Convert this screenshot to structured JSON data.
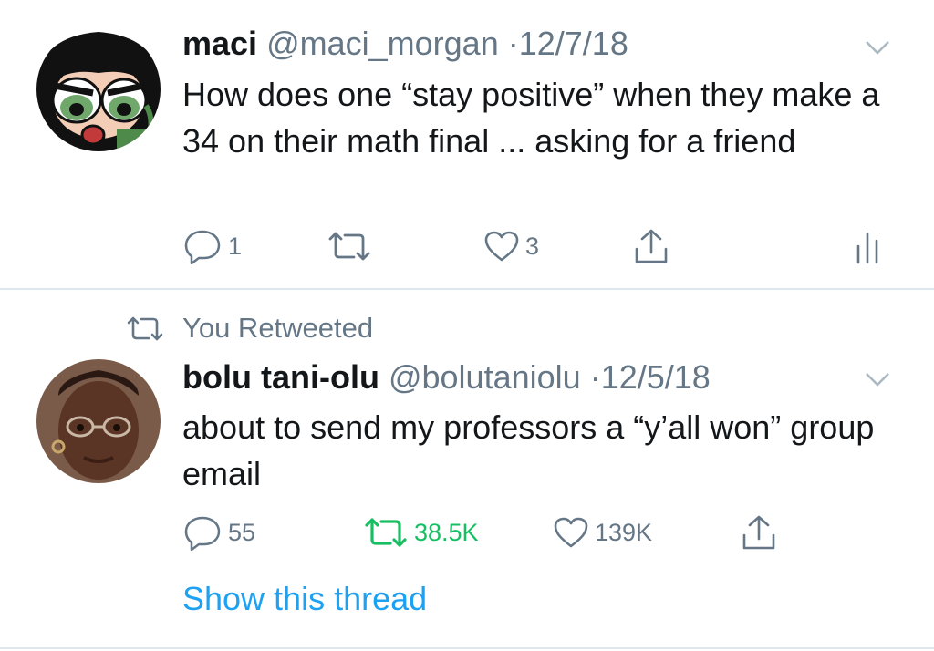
{
  "tweets": [
    {
      "name": "maci",
      "handle": "@maci_morgan",
      "sep": "·",
      "date": "12/7/18",
      "text": "How does one “stay positive” when they make a 34 on their math final ... asking for a friend",
      "replies": "1",
      "retweets": "",
      "likes": "3",
      "avatar_icon": "cartoon-character-avatar"
    },
    {
      "retweeted_label": "You Retweeted",
      "name": "bolu tani-olu",
      "handle": "@bolutaniolu",
      "sep": "·",
      "date": "12/5/18",
      "text": "about to send my professors a “y’all won” group email",
      "replies": "55",
      "retweets": "38.5K",
      "likes": "139K",
      "show_thread": "Show this thread",
      "avatar_icon": "child-photo-avatar"
    }
  ],
  "colors": {
    "text": "#14171a",
    "secondary": "#657786",
    "retweet_active": "#17bf63",
    "link": "#1da1f2",
    "divider": "#e1e8ed"
  }
}
